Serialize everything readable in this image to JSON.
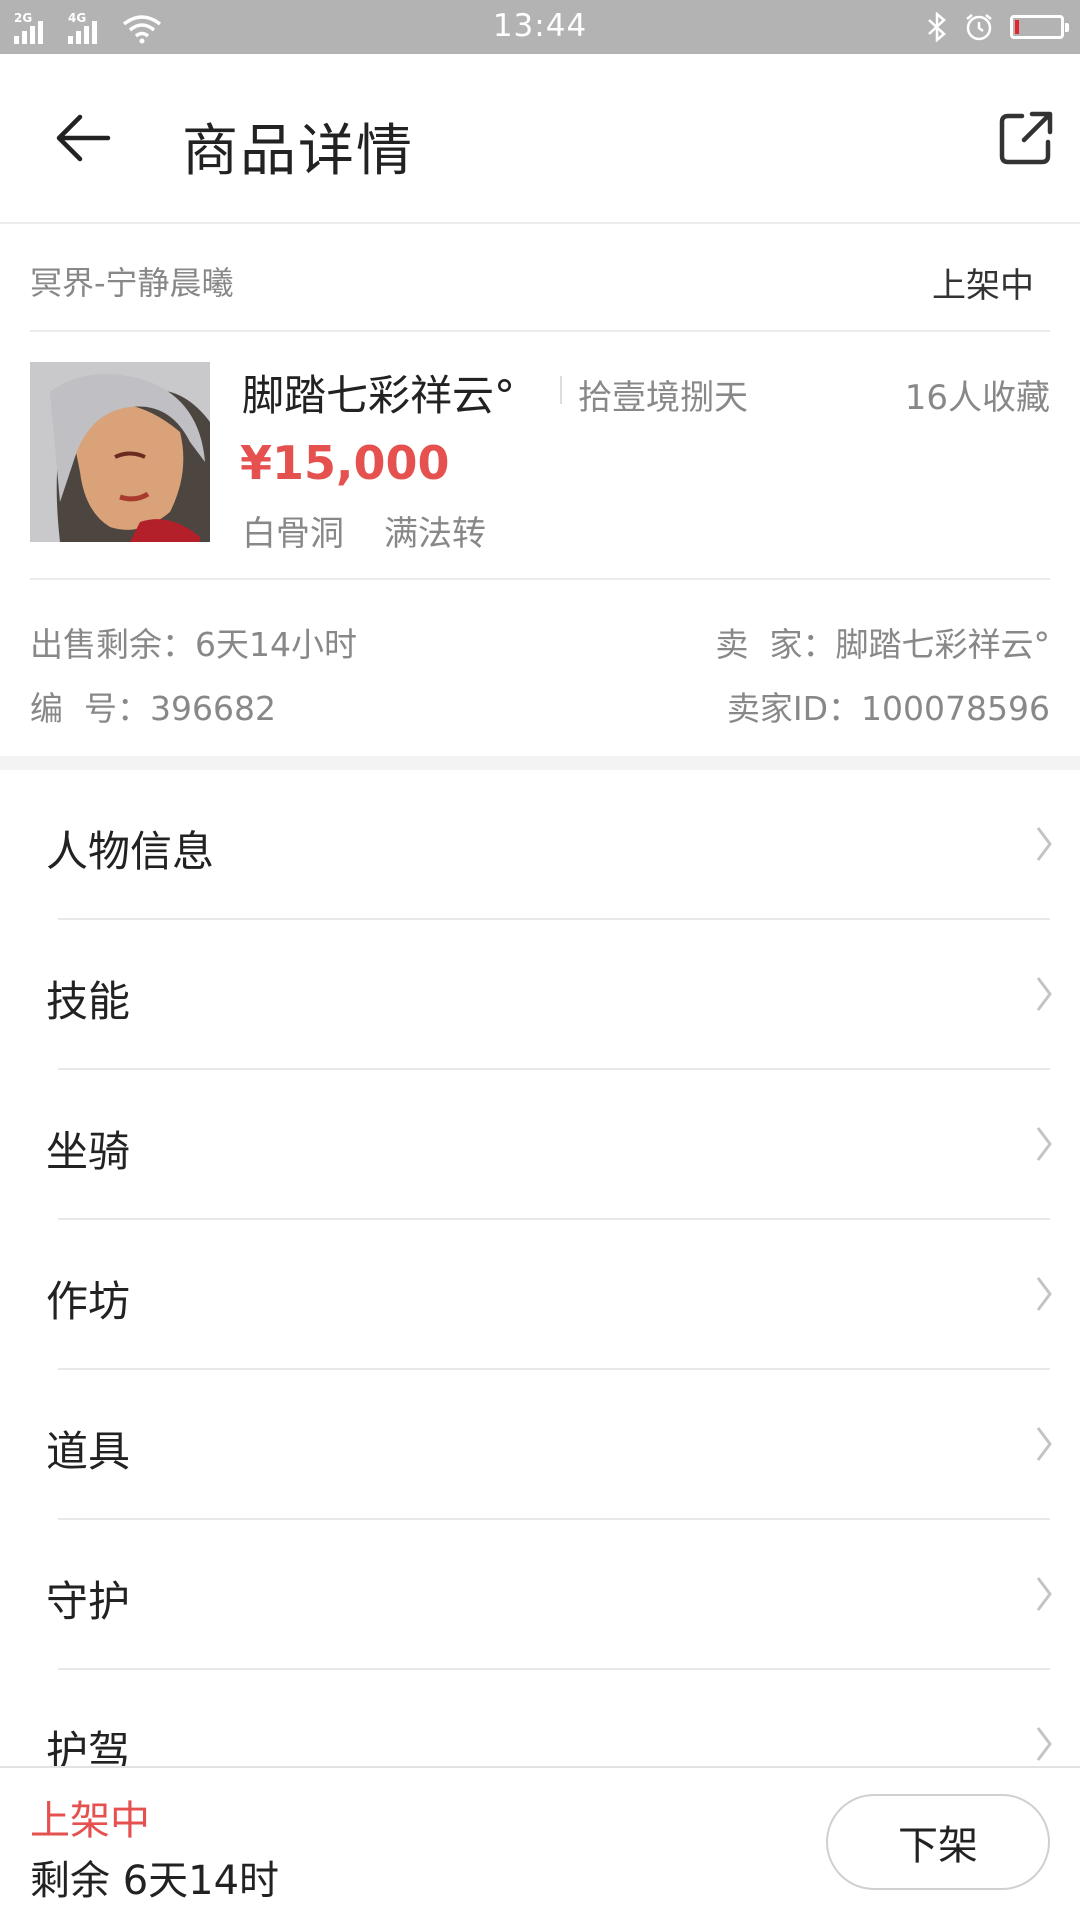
{
  "status_bar": {
    "network_1": "2G",
    "network_2": "4G",
    "time": "13:44",
    "battery_level_fraction": 0.1
  },
  "header": {
    "title": "商品详情",
    "back_icon": "arrow-left-icon",
    "share_icon": "share-external-icon"
  },
  "listing": {
    "region": "冥界-宁静晨曦",
    "status": "上架中",
    "character_name": "脚踏七彩祥云°",
    "server": "拾壹境捌天",
    "favorites": "16人收藏",
    "price": "¥15,000",
    "sect": "白骨洞",
    "transmigration": "满法转",
    "time_left_label": "出售剩余：",
    "time_left_value": "6天14小时",
    "seller_label": "卖  家：",
    "seller_value": "脚踏七彩祥云°",
    "number_label": "编  号：",
    "number_value": "396682",
    "seller_id_label": "卖家ID：",
    "seller_id_value": "100078596"
  },
  "menu": {
    "items": [
      "人物信息",
      "技能",
      "坐骑",
      "作坊",
      "道具",
      "守护",
      "护驾"
    ]
  },
  "bottom_bar": {
    "status": "上架中",
    "remaining": "剩余 6天14时",
    "delist_button": "下架"
  },
  "colors": {
    "accent_red": "#e5514f",
    "status_bar_bg": "#b3b3b3",
    "battery_red": "#e5242b"
  }
}
